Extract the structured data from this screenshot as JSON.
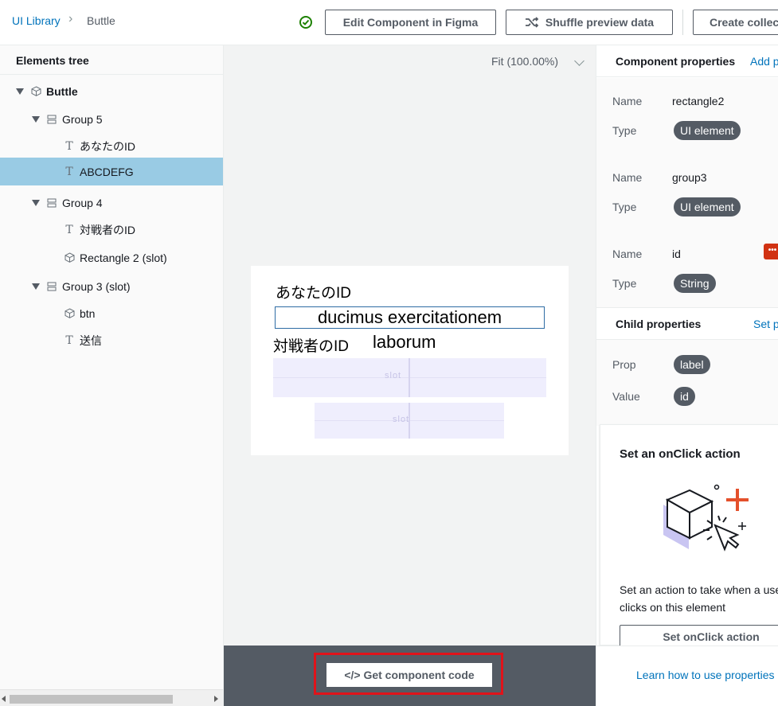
{
  "breadcrumb": {
    "root": "UI Library",
    "current": "Buttle"
  },
  "toolbar": {
    "edit_figma": "Edit Component in Figma",
    "shuffle": "Shuffle preview data",
    "create": "Create collection"
  },
  "elements_tree": {
    "title": "Elements tree",
    "items": [
      {
        "label": "Buttle",
        "icon": "component-icon"
      },
      {
        "label": "Group 5",
        "icon": "group-icon"
      },
      {
        "label": "あなたのID",
        "icon": "text-icon"
      },
      {
        "label": "ABCDEFG",
        "icon": "text-icon",
        "selected": true
      },
      {
        "label": "Group 4",
        "icon": "group-icon"
      },
      {
        "label": "対戦者のID",
        "icon": "text-icon"
      },
      {
        "label": "Rectangle 2 (slot)",
        "icon": "component-icon"
      },
      {
        "label": "Group 3 (slot)",
        "icon": "group-icon"
      },
      {
        "label": "btn",
        "icon": "component-icon"
      },
      {
        "label": "送信",
        "icon": "text-icon"
      }
    ]
  },
  "canvas": {
    "zoom": "Fit (100.00%)",
    "preview": {
      "label1": "あなたのID",
      "input_value": "ducimus exercitationem",
      "label2": "対戦者のID",
      "value2": "laborum",
      "slot_text": "slot"
    },
    "code_button": "</> Get component code"
  },
  "component_properties": {
    "title": "Component properties",
    "add_link": "Add prop",
    "name_key": "Name",
    "type_key": "Type",
    "items": [
      {
        "name": "rectangle2",
        "type": "UI element"
      },
      {
        "name": "group3",
        "type": "UI element"
      },
      {
        "name": "id",
        "type": "String"
      }
    ],
    "menu_icon": "•••"
  },
  "child_properties": {
    "title": "Child properties",
    "set_link": "Set prop",
    "prop_key": "Prop",
    "prop_value": "label",
    "value_key": "Value",
    "value_value": "id"
  },
  "onclick_card": {
    "title": "Set an onClick action",
    "description": "Set an action to take when a user clicks on this element",
    "button": "Set onClick action"
  },
  "learn_link": "Learn how to use properties",
  "colors": {
    "accent": "#0073bb",
    "selected_row": "#99cbe4",
    "highlight": "#e0131a"
  }
}
